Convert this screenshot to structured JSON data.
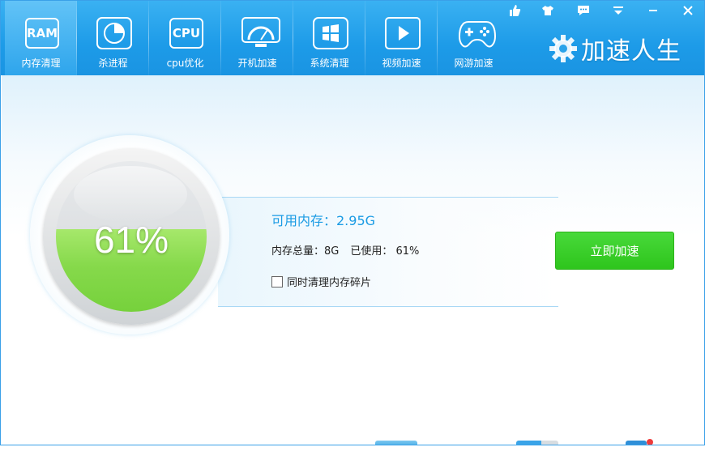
{
  "nav": {
    "items": [
      {
        "label": "内存清理",
        "icon_text": "RAM",
        "icon": "ram-icon",
        "active": true
      },
      {
        "label": "杀进程",
        "icon": "pie-chart-icon",
        "active": false
      },
      {
        "label": "cpu优化",
        "icon_text": "CPU",
        "icon": "cpu-icon",
        "active": false
      },
      {
        "label": "开机加速",
        "icon": "speedometer-icon",
        "active": false
      },
      {
        "label": "系统清理",
        "icon": "windows-icon",
        "active": false
      },
      {
        "label": "视频加速",
        "icon": "play-icon",
        "active": false
      },
      {
        "label": "网游加速",
        "icon": "gamepad-icon",
        "active": false
      }
    ]
  },
  "brand": {
    "name": "加速人生",
    "icon": "gear-logo-icon"
  },
  "window_controls": [
    "like-icon",
    "skin-icon",
    "feedback-icon",
    "menu-icon",
    "minimize-icon",
    "close-icon"
  ],
  "memory": {
    "percent_text": "61%",
    "used_fraction": 0.61,
    "available": "可用内存：2.95G",
    "total": "内存总量：8G",
    "used": "已使用： 61%",
    "clean_fragments_label": "同时清理内存碎片",
    "clean_fragments_checked": false
  },
  "accelerate_button": "立即加速",
  "colors": {
    "topbar": "#1d9be8",
    "accent_text": "#1a9be4",
    "gauge_green": "#86d94b",
    "button_green": "#2ec51c"
  }
}
